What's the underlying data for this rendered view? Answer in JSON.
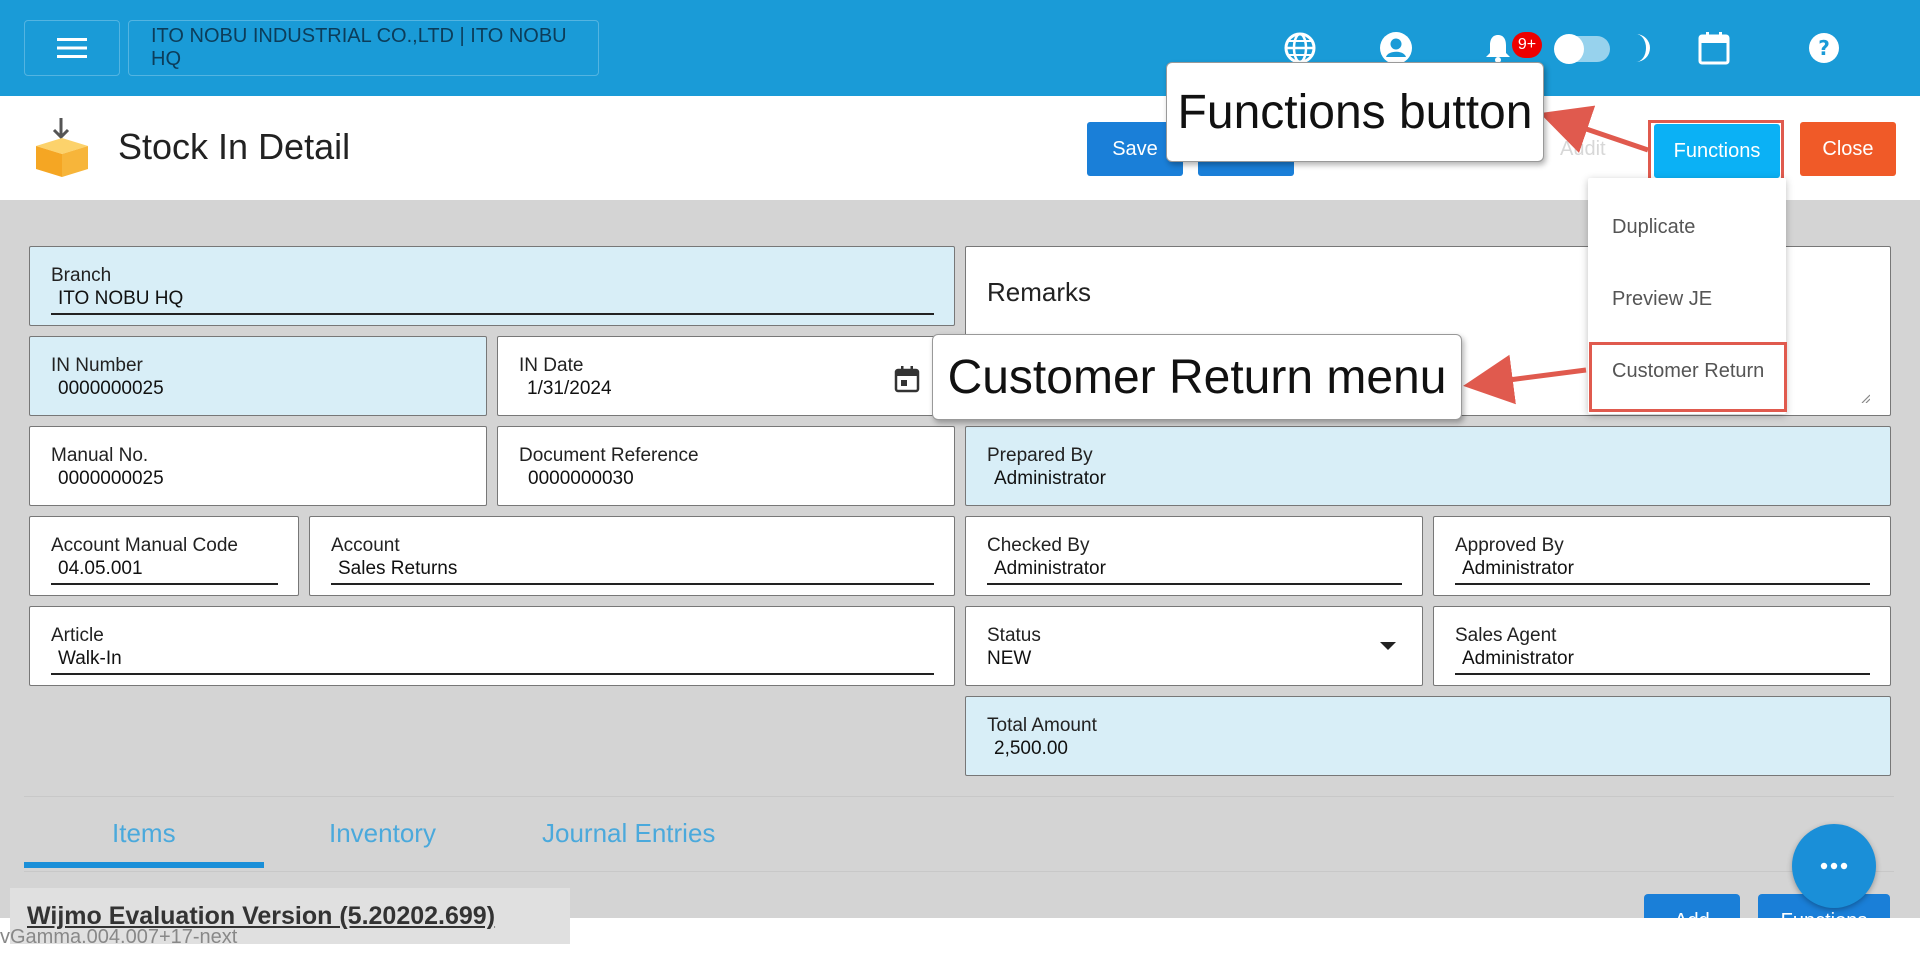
{
  "topbar": {
    "company": "ITO NOBU INDUSTRIAL CO.,LTD | ITO NOBU HQ",
    "notification_badge": "9+",
    "icons": [
      "menu-icon",
      "globe-icon",
      "user-icon",
      "bell-icon",
      "moon-icon",
      "calendar-icon",
      "help-icon"
    ]
  },
  "header": {
    "title": "Stock In Detail",
    "save_label": "Save",
    "audit_label": "Audit",
    "functions_label": "Functions",
    "close_label": "Close"
  },
  "functions_menu": {
    "items": [
      "Duplicate",
      "Preview JE",
      "Customer Return"
    ]
  },
  "callouts": {
    "functions": "Functions button",
    "customer_return": "Customer Return menu"
  },
  "form": {
    "branch": {
      "label": "Branch",
      "value": "ITO NOBU HQ"
    },
    "remarks": {
      "label": "Remarks"
    },
    "in_number": {
      "label": "IN Number",
      "value": "0000000025"
    },
    "in_date": {
      "label": "IN Date",
      "value": "1/31/2024"
    },
    "manual_no": {
      "label": "Manual No.",
      "value": "0000000025"
    },
    "document_reference": {
      "label": "Document Reference",
      "value": "0000000030"
    },
    "prepared_by": {
      "label": "Prepared By",
      "value": "Administrator"
    },
    "account_manual_code": {
      "label": "Account Manual Code",
      "value": "04.05.001"
    },
    "account": {
      "label": "Account",
      "value": "Sales Returns"
    },
    "checked_by": {
      "label": "Checked By",
      "value": "Administrator"
    },
    "approved_by": {
      "label": "Approved By",
      "value": "Administrator"
    },
    "article": {
      "label": "Article",
      "value": "Walk-In"
    },
    "status": {
      "label": "Status",
      "value": "NEW"
    },
    "sales_agent": {
      "label": "Sales Agent",
      "value": "Administrator"
    },
    "total_amount": {
      "label": "Total Amount",
      "value": "2,500.00"
    }
  },
  "tabs": [
    {
      "label": "Items",
      "active": true
    },
    {
      "label": "Inventory",
      "active": false
    },
    {
      "label": "Journal Entries",
      "active": false
    }
  ],
  "bottom": {
    "add_label": "Add",
    "functions_label": "Functions",
    "wijmo_notice": "Wijmo Evaluation Version (5.20202.699)",
    "version": "vGamma.004.007+17-next"
  },
  "colors": {
    "topbar": "#1a9bd7",
    "primary_button": "#1a7fd8",
    "functions_button": "#0bb1f5",
    "close_button": "#f05a28",
    "highlight": "#e05a4e",
    "readonly_field": "#d8eef7"
  }
}
